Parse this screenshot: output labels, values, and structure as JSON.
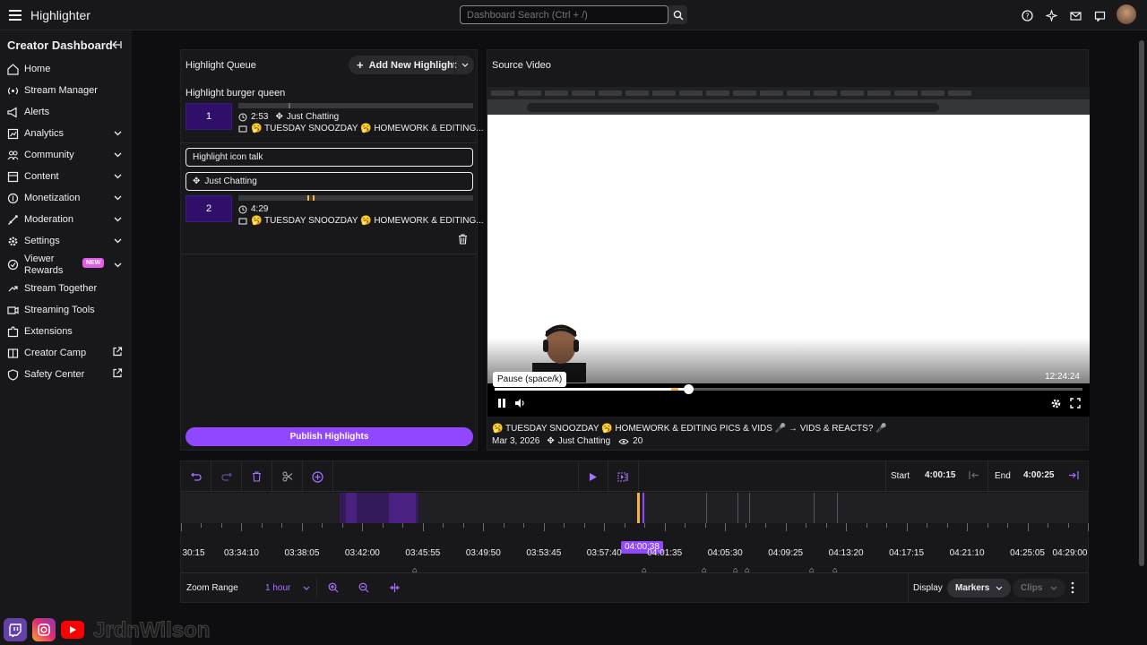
{
  "topbar": {
    "app_title": "Highlighter",
    "search_placeholder": "Dashboard Search (Ctrl + /)"
  },
  "sidebar": {
    "title": "Creator Dashboard",
    "items": [
      {
        "label": "Home",
        "icon": "home-icon",
        "chevron": false,
        "external": false
      },
      {
        "label": "Stream Manager",
        "icon": "broadcast-icon",
        "chevron": false,
        "external": false
      },
      {
        "label": "Alerts",
        "icon": "megaphone-icon",
        "chevron": false,
        "external": false
      },
      {
        "label": "Analytics",
        "icon": "chart-icon",
        "chevron": true,
        "external": false
      },
      {
        "label": "Community",
        "icon": "people-icon",
        "chevron": true,
        "external": false
      },
      {
        "label": "Content",
        "icon": "content-icon",
        "chevron": true,
        "external": false
      },
      {
        "label": "Monetization",
        "icon": "coins-icon",
        "chevron": true,
        "external": false
      },
      {
        "label": "Moderation",
        "icon": "sword-icon",
        "chevron": true,
        "external": false
      },
      {
        "label": "Settings",
        "icon": "gear-icon",
        "chevron": true,
        "external": false
      },
      {
        "label": "Viewer Rewards",
        "icon": "rewards-icon",
        "chevron": true,
        "external": false,
        "badge": "NEW"
      },
      {
        "label": "Stream Together",
        "icon": "collab-icon",
        "chevron": false,
        "external": false
      },
      {
        "label": "Streaming Tools",
        "icon": "camera-icon",
        "chevron": false,
        "external": false
      },
      {
        "label": "Extensions",
        "icon": "puzzle-icon",
        "chevron": false,
        "external": false
      },
      {
        "label": "Creator Camp",
        "icon": "book-icon",
        "chevron": false,
        "external": true
      },
      {
        "label": "Safety Center",
        "icon": "shield-icon",
        "chevron": false,
        "external": true
      }
    ]
  },
  "queue": {
    "title": "Highlight Queue",
    "add_label": "Add New Highlight",
    "highlight_name": "Highlight burger queen",
    "item1": {
      "num": "1",
      "duration": "2:53",
      "category": "Just Chatting",
      "stream_title": "🥱 TUESDAY SNOOZDAY 🥱 HOMEWORK & EDITING..."
    },
    "title_field": "Highlight icon talk",
    "category_field": "Just Chatting",
    "item2": {
      "num": "2",
      "duration": "4:29",
      "stream_title": "🥱 TUESDAY SNOOZDAY 🥱 HOMEWORK & EDITING..."
    },
    "publish_label": "Publish Highlights"
  },
  "source": {
    "title": "Source Video",
    "video_time": "12:24:24",
    "tooltip": "Pause (space/k)",
    "video_title": "🥱 TUESDAY SNOOZDAY 🥱 HOMEWORK & EDITING PICS & VIDS 🎤 → VIDS & REACTS? 🎤",
    "date": "Mar 3, 2026",
    "category": "Just Chatting",
    "views": "20",
    "progress": 0.33
  },
  "timeline": {
    "start_label": "Start",
    "start_value": "4:00:15",
    "end_label": "End",
    "end_value": "4:00:25",
    "playhead_time": "04:00:38",
    "ticks": [
      "30:15",
      "03:34:10",
      "03:38:05",
      "03:42:00",
      "03:45:55",
      "03:49:50",
      "03:53:45",
      "03:57:40",
      "04:01:35",
      "04:05:30",
      "04:09:25",
      "04:13:20",
      "04:17:15",
      "04:21:10",
      "04:25:05",
      "04:29:00"
    ],
    "zoom_label": "Zoom Range",
    "zoom_value": "1 hour",
    "display_label": "Display",
    "markers_label": "Markers",
    "clips_label": "Clips"
  },
  "overlay": {
    "handle": "JrdnWilson"
  },
  "colors": {
    "accent": "#9147ff",
    "background": "#0e0e10",
    "panel": "#18181b",
    "marker": "#f5b53a"
  }
}
